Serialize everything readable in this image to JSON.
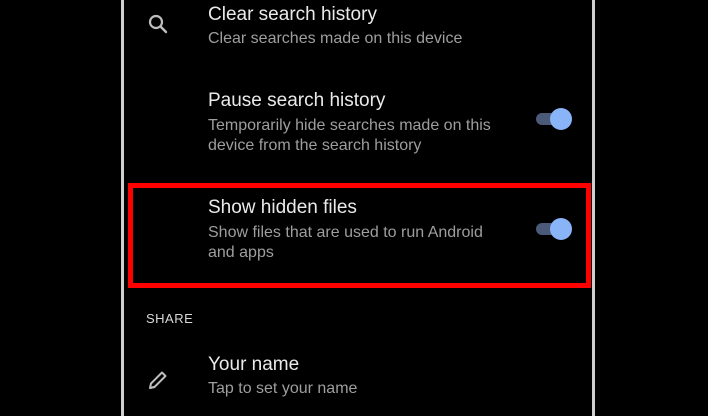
{
  "settings": {
    "clear_history": {
      "title": "Clear search history",
      "subtitle": "Clear searches made on this device",
      "icon": "search-icon"
    },
    "pause_history": {
      "title": "Pause search history",
      "subtitle": "Temporarily hide searches made on this device from the search history",
      "enabled": true
    },
    "hidden_files": {
      "title": "Show hidden files",
      "subtitle": "Show files that are used to run Android and apps",
      "enabled": true
    },
    "share_header": "SHARE",
    "your_name": {
      "title": "Your name",
      "subtitle": "Tap to set your name",
      "icon": "pencil-icon"
    }
  },
  "colors": {
    "toggle_thumb": "#8ab4f8",
    "toggle_track": "#4a5a78",
    "highlight": "#ff0000"
  }
}
